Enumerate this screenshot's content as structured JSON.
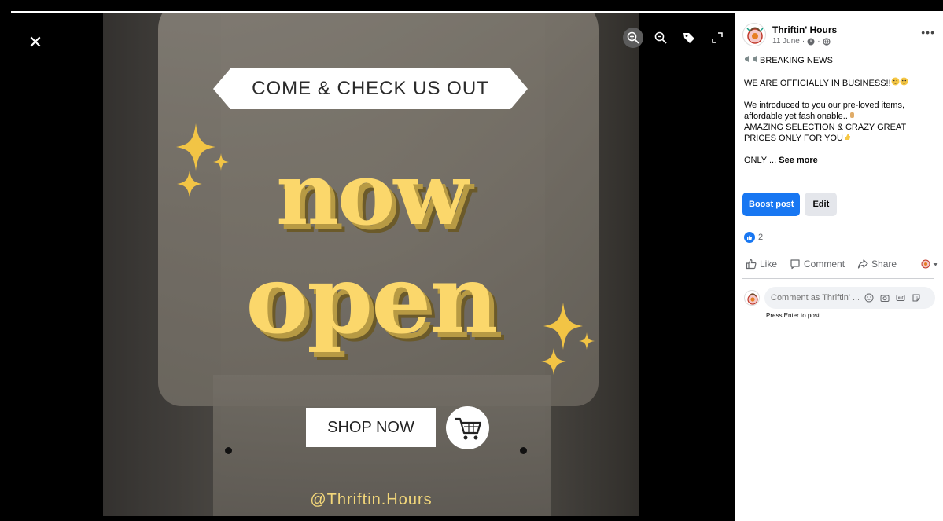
{
  "viewer": {
    "close_label": "✕",
    "tools": [
      {
        "name": "zoom-in-icon"
      },
      {
        "name": "zoom-out-icon"
      },
      {
        "name": "tag-icon"
      },
      {
        "name": "fullscreen-icon"
      }
    ]
  },
  "photo": {
    "banner_text": "COME & CHECK US OUT",
    "headline_line1": "now",
    "headline_line2": "open",
    "cta_text": "SHOP NOW",
    "handle": "@Thriftin.Hours",
    "colors": {
      "headline": "#fbd76b",
      "handle": "#f3d77a"
    }
  },
  "post": {
    "page_name": "Thriftin' Hours",
    "date": "11 June",
    "sep": "·",
    "more_label": "•••",
    "line_breaking": "BREAKING NEWS",
    "line_official": "WE ARE OFFICIALLY IN BUSINESS!!",
    "line_intro": "We introduced to you our pre-loved items, affordable yet fashionable..",
    "line_amazing": "AMAZING SELECTION & CRAZY GREAT PRICES ONLY FOR YOU",
    "line_only": "ONLY ...",
    "see_more": "See more",
    "boost_label": "Boost post",
    "edit_label": "Edit",
    "reaction_count": "2",
    "like_label": "Like",
    "comment_label": "Comment",
    "share_label": "Share",
    "comment_placeholder": "Comment as Thriftin' ...",
    "press_enter": "Press Enter to post.",
    "colors": {
      "primary": "#1877f2",
      "secondary_btn": "#e4e6eb",
      "muted": "#65676b"
    }
  }
}
